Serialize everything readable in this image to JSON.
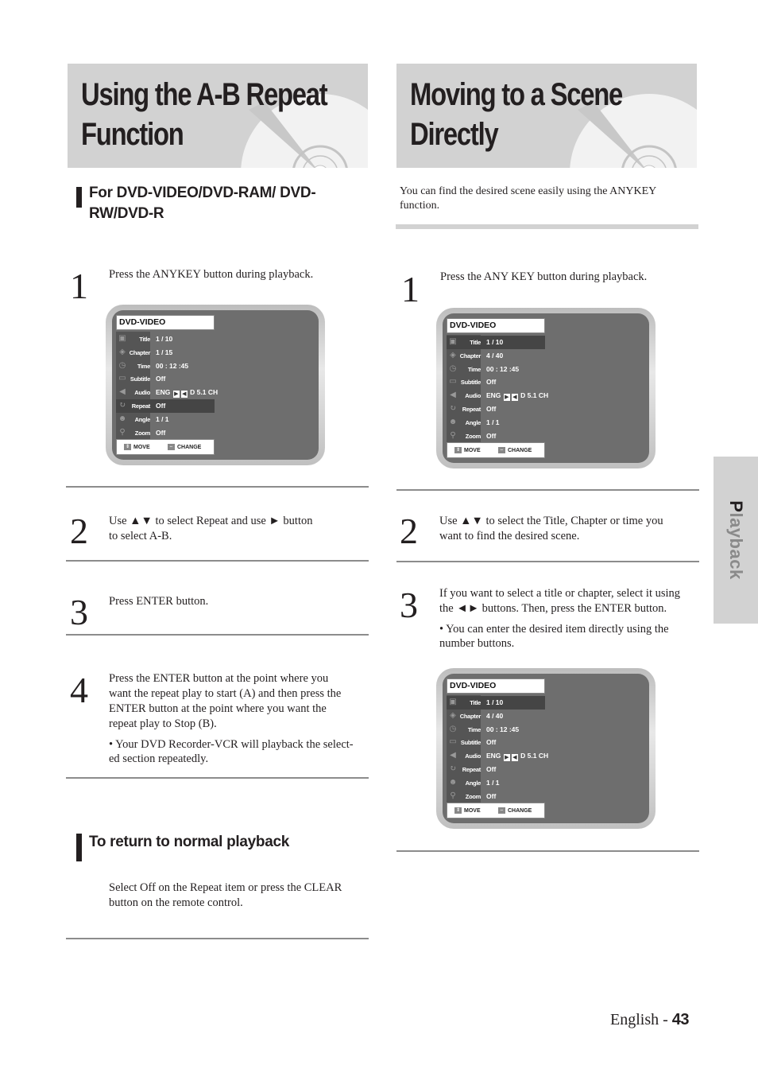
{
  "left": {
    "title_line1": "Using the A-B Repeat",
    "title_line2": "Function",
    "subheading_line1": "For DVD-VIDEO/DVD-RAM/ DVD-",
    "subheading_line2": "RW/DVD-R",
    "steps": [
      {
        "num": "1",
        "text": "Press the ANYKEY button during playback."
      },
      {
        "num": "2",
        "line1": "Use ▲▼ to select Repeat and use ► button",
        "line2": "to select A-B."
      },
      {
        "num": "3",
        "text": "Press ENTER button."
      },
      {
        "num": "4",
        "lines": [
          "Press the ENTER button at the point where you",
          "want the repeat play to start (A) and then press the",
          "ENTER button at the point where you want the",
          "repeat play to Stop (B)."
        ],
        "bullet_line1": "• Your DVD Recorder-VCR will playback the select-",
        "bullet_line2": "ed section repeatedly."
      }
    ],
    "return_heading": "To return to normal playback",
    "return_line1": "Select Off on the Repeat item or press the CLEAR",
    "return_line2": "button on the remote control."
  },
  "right": {
    "title_line1": "Moving to a Scene",
    "title_line2": "Directly",
    "intro_line1": "You can find the desired scene easily using the ANYKEY",
    "intro_line2": "function.",
    "steps": [
      {
        "num": "1",
        "text": "Press the ANY KEY button during playback."
      },
      {
        "num": "2",
        "line1": "Use ▲▼ to select the Title, Chapter or time you",
        "line2": "want to find the desired scene."
      },
      {
        "num": "3",
        "line1": "If you want to select a title or chapter, select it using",
        "line2": "the ◄► buttons. Then, press the ENTER button.",
        "bullet_line1": "• You can enter the desired item directly using the",
        "bullet_line2": "number buttons."
      }
    ]
  },
  "osd_screens": [
    {
      "header": "DVD-VIDEO",
      "selected_row": "Repeat",
      "rows": [
        {
          "label": "Title",
          "value": "1 / 10",
          "icon": "title-icon"
        },
        {
          "label": "Chapter",
          "value": "1 / 15",
          "icon": "chapter-icon"
        },
        {
          "label": "Time",
          "value": "00 : 12 :45",
          "icon": "clock-icon"
        },
        {
          "label": "Subtitle",
          "value": "Off",
          "icon": "subtitle-icon"
        },
        {
          "label": "Audio",
          "value_prefix": "ENG",
          "value_suffix": "D 5.1 CH",
          "icon": "speaker-icon"
        },
        {
          "label": "Repeat",
          "value": "Off",
          "icon": "repeat-icon"
        },
        {
          "label": "Angle",
          "value": "1 / 1",
          "icon": "angle-icon"
        },
        {
          "label": "Zoom",
          "value": "Off",
          "icon": "zoom-icon"
        }
      ],
      "footer_move": "MOVE",
      "footer_change": "CHANGE"
    },
    {
      "header": "DVD-VIDEO",
      "selected_row": "Title",
      "rows": [
        {
          "label": "Title",
          "value": "1 / 10"
        },
        {
          "label": "Chapter",
          "value": "4 / 40"
        },
        {
          "label": "Time",
          "value": "00 : 12 :45"
        },
        {
          "label": "Subtitle",
          "value": "Off"
        },
        {
          "label": "Audio",
          "value_prefix": "ENG",
          "value_suffix": "D 5.1 CH"
        },
        {
          "label": "Repeat",
          "value": "Off"
        },
        {
          "label": "Angle",
          "value": "1 / 1"
        },
        {
          "label": "Zoom",
          "value": "Off"
        }
      ],
      "footer_move": "MOVE",
      "footer_change": "CHANGE"
    },
    {
      "header": "DVD-VIDEO",
      "selected_row": "Title",
      "rows": [
        {
          "label": "Title",
          "value": "1 / 10"
        },
        {
          "label": "Chapter",
          "value": "4 / 40"
        },
        {
          "label": "Time",
          "value": "00 : 12 :45"
        },
        {
          "label": "Subtitle",
          "value": "Off"
        },
        {
          "label": "Audio",
          "value_prefix": "ENG",
          "value_suffix": "D 5.1 CH"
        },
        {
          "label": "Repeat",
          "value": "Off"
        },
        {
          "label": "Angle",
          "value": "1 / 1"
        },
        {
          "label": "Zoom",
          "value": "Off"
        }
      ],
      "footer_move": "MOVE",
      "footer_change": "CHANGE"
    }
  ],
  "side_tab": {
    "first_letter": "P",
    "rest": "layback"
  },
  "footer": {
    "language": "English - ",
    "page_number": "43"
  }
}
